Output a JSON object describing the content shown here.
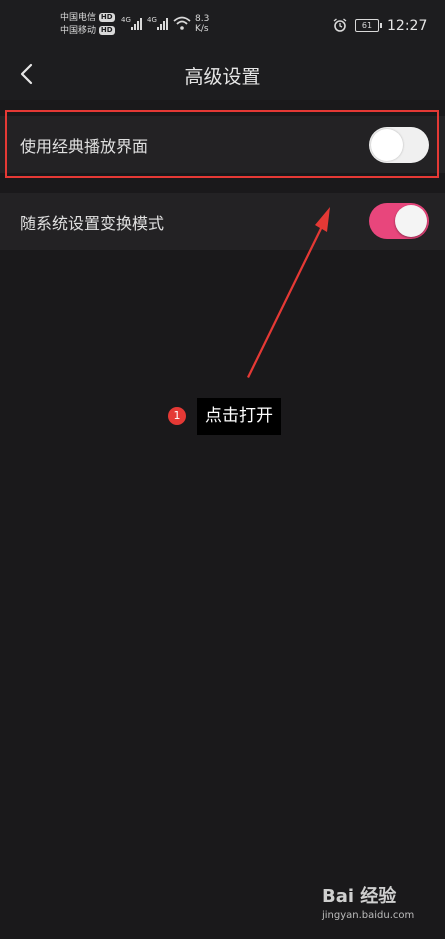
{
  "statusbar": {
    "carrier1": "中国电信",
    "carrier2": "中国移动",
    "hd": "HD",
    "net": "4G",
    "speed_value": "8.3",
    "speed_unit": "K/s",
    "battery": "61",
    "time": "12:27"
  },
  "header": {
    "title": "高级设置",
    "back_icon": "chevron-left-icon"
  },
  "settings": [
    {
      "label": "使用经典播放界面",
      "enabled": false
    },
    {
      "label": "随系统设置变换模式",
      "enabled": true
    }
  ],
  "annotation": {
    "step": "1",
    "text": "点击打开",
    "color": "#e53935"
  },
  "watermark": {
    "logo": "Bai 经验",
    "url": "jingyan.baidu.com"
  },
  "colors": {
    "accent": "#e8467c",
    "background": "#1a191b"
  }
}
